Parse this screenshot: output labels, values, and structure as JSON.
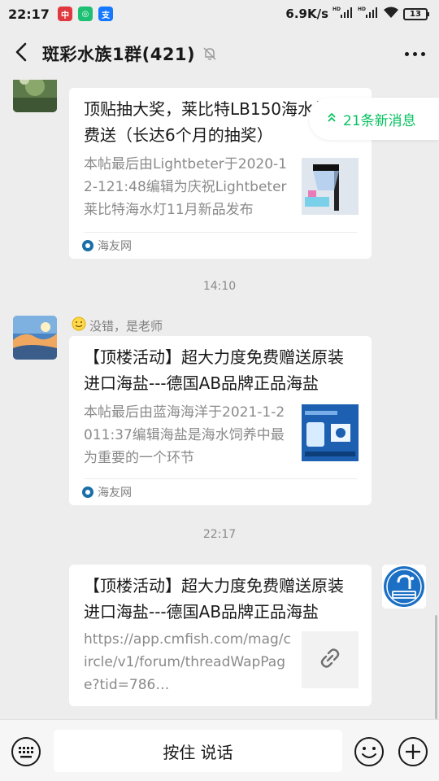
{
  "status_bar": {
    "time": "22:17",
    "net_speed": "6.9K/s",
    "hd1": "HD",
    "hd2": "HD",
    "battery": "13",
    "notif_colors": [
      "#e0383e",
      "#1dbf73",
      "#1677ff"
    ]
  },
  "header": {
    "title": "斑彩水族1群(421)",
    "icons": {
      "back": "back-arrow-icon",
      "mute": "mute-bell-icon",
      "more": "more-dots-icon"
    }
  },
  "new_messages": {
    "label": "21条新消息",
    "icon": "double-chevron-up-icon"
  },
  "messages": [
    {
      "type": "card",
      "sender": "",
      "title": "顶贴抽大奖，莱比特LB150海水灯免费送（长达6个月的抽奖）",
      "desc": "本帖最后由Lightbeter于2020-12-121:48编辑为庆祝Lightbeter莱比特海水灯11月新品发布",
      "source": "海友网"
    },
    {
      "type": "time",
      "text": "14:10"
    },
    {
      "type": "card",
      "sender": "没错，是老师",
      "title": "【顶楼活动】超大力度免费赠送原装进口海盐---德国AB品牌正品海盐",
      "desc": "本帖最后由蓝海海洋于2021-1-2011:37编辑海盐是海水饲养中最为重要的一个环节",
      "source": "海友网"
    },
    {
      "type": "time",
      "text": "22:17"
    },
    {
      "type": "link",
      "title": "【顶楼活动】超大力度免费赠送原装进口海盐---德国AB品牌正品海盐",
      "url": "https://app.cmfish.com/mag/circle/v1/forum/threadWapPage?tid=786…"
    }
  ],
  "bottom_bar": {
    "talk_label": "按住 说话",
    "icons": {
      "keyboard": "keyboard-icon",
      "emoji": "emoji-icon",
      "plus": "plus-icon"
    }
  },
  "colors": {
    "accent": "#07c160",
    "background": "#ededed",
    "card": "#ffffff"
  }
}
